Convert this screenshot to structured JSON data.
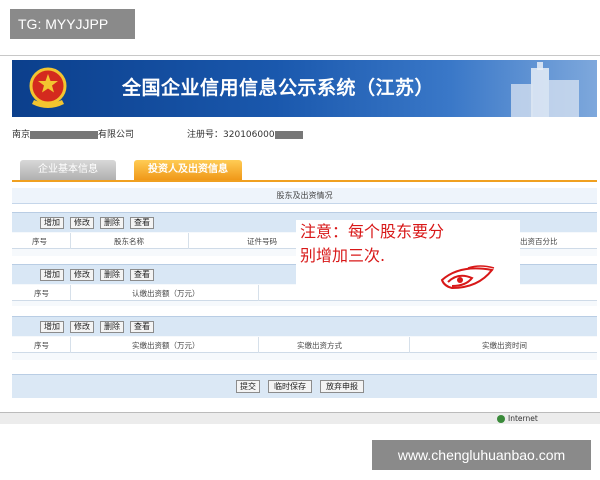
{
  "watermark": {
    "tag": "TG: MYYJJPP",
    "url": "www.chengluhuanbao.com"
  },
  "banner": {
    "title": "全国企业信用信息公示系统（江苏）"
  },
  "company": {
    "name_prefix": "南京",
    "name_suffix": "有限公司",
    "reg_label": "注册号：",
    "reg_value": "320106000"
  },
  "tabs": [
    {
      "label": "企业基本信息"
    },
    {
      "label": "投资人及出资信息"
    }
  ],
  "section": {
    "title": "股东及出资情况"
  },
  "toolbar_buttons": [
    "增加",
    "修改",
    "删除",
    "查看"
  ],
  "table1": {
    "headers": [
      "序号",
      "股东名称",
      "证件号码",
      "出资百分比"
    ]
  },
  "table2": {
    "headers": [
      "序号",
      "认缴出资额（万元）"
    ]
  },
  "table3": {
    "headers": [
      "序号",
      "实缴出资额（万元）",
      "实缴出资方式",
      "实缴出资时间"
    ]
  },
  "bottom_buttons": [
    "提交",
    "临时保存",
    "放弃申报"
  ],
  "statusbar": {
    "zone": "Internet"
  },
  "annotation": {
    "line1": "注意：每个股东要分",
    "line2": "别增加三次."
  },
  "colors": {
    "banner": "#1a58ad",
    "active_tab": "#f09818",
    "note_red": "#d81818"
  }
}
